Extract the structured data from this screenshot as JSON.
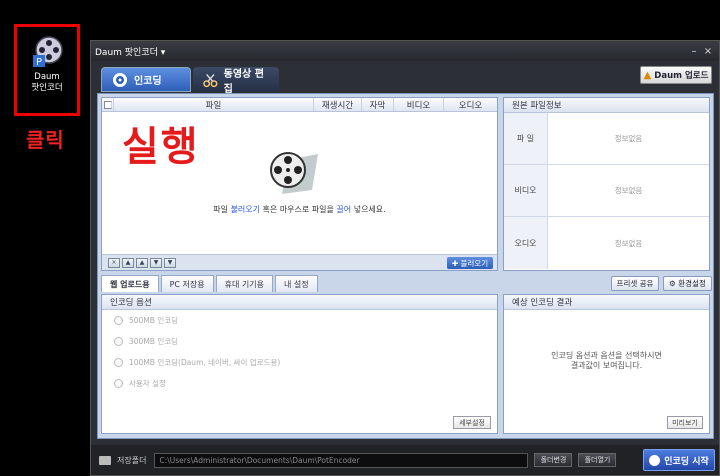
{
  "desktop": {
    "icon_label_line1": "Daum",
    "icon_label_line2": "팟인코더",
    "click_annotation": "클릭"
  },
  "window": {
    "title": "Daum 팟인코더 ▾",
    "minimize": "–",
    "close": "×"
  },
  "toolbar": {
    "tab_encoding": "인코딩",
    "tab_edit": "동영상 편집",
    "upload_button": "Daum 업로드"
  },
  "filelist": {
    "headers": [
      "파일",
      "재생시간",
      "자막",
      "비디오",
      "오디오"
    ],
    "annotation": "실행",
    "hint_prefix": "파일 ",
    "hint_link1": "불러오기",
    "hint_mid": " 혹은 마우스로 파일을 ",
    "hint_link2": "끌어",
    "hint_suffix": " 넣으세요.",
    "load_button": "불러오기"
  },
  "origin_info": {
    "title": "원본 파일정보",
    "rows": [
      {
        "key": "파 일",
        "value": "정보없음"
      },
      {
        "key": "비디오",
        "value": "정보없음"
      },
      {
        "key": "오디오",
        "value": "정보없음"
      }
    ]
  },
  "subtabs": [
    "웹 업로드용",
    "PC 저장용",
    "휴대 기기용",
    "내 설정"
  ],
  "preset_button": "프리셋 공유",
  "env_button": "환경설정",
  "options": {
    "title": "인코딩 옵션",
    "items": [
      "500MB 인코딩",
      "300MB 인코딩",
      "100MB 인코딩(Daum, 네이버, 싸이 업로드용)",
      "사용자 설정"
    ],
    "detail_button": "세부설정"
  },
  "result": {
    "title": "예상 인코딩 결과",
    "message_line1": "인코딩 옵션과 옵션을 선택하시면",
    "message_line2": "결과값이 보여집니다.",
    "preview_button": "미리보기"
  },
  "bottom": {
    "save_label": "저장폴더",
    "path": "C:\\Users\\Administrator\\Documents\\Daum\\PotEncoder",
    "change_button": "폴더변경",
    "open_button": "폴더열기",
    "start_button": "인코딩 시작"
  },
  "colors": {
    "accent": "#2e5fb8",
    "annotation_red": "#e51a1a"
  }
}
